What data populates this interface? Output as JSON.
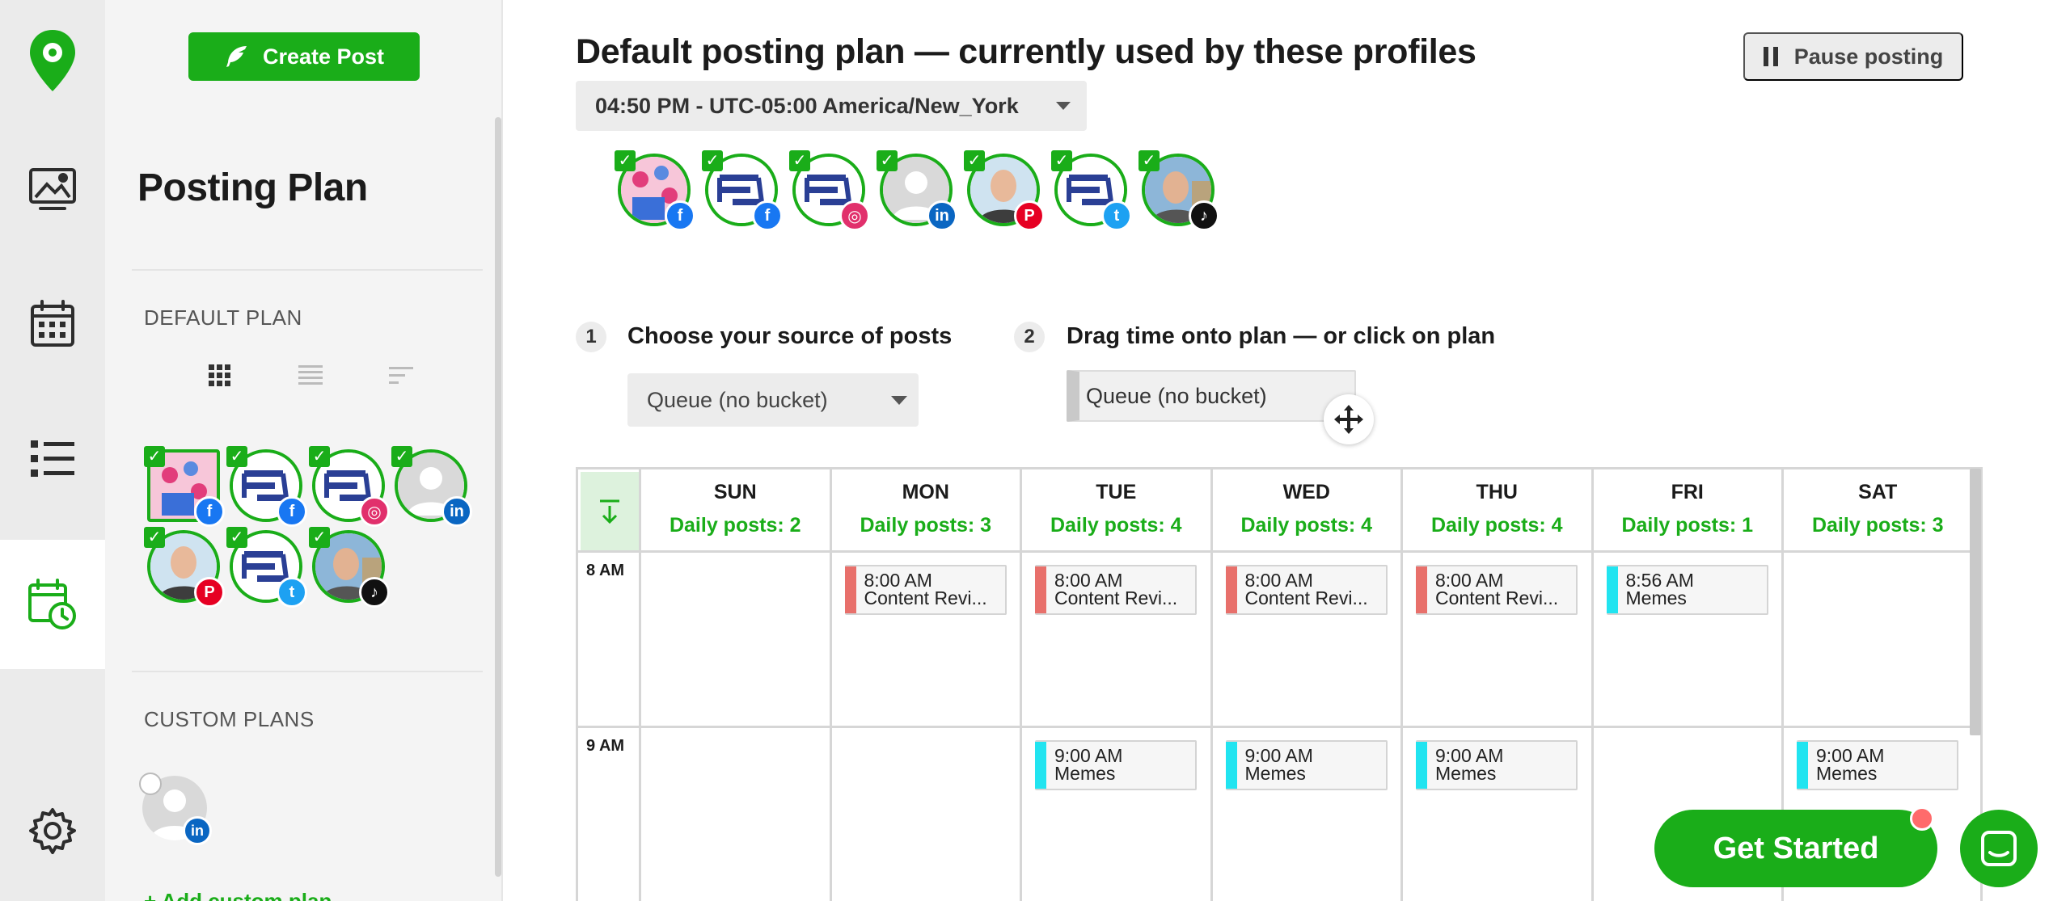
{
  "app": {
    "brand_color": "#1aad19"
  },
  "rail": {
    "items": [
      {
        "icon": "logo-pin-icon"
      },
      {
        "icon": "media-library-icon"
      },
      {
        "icon": "calendar-icon"
      },
      {
        "icon": "list-icon"
      },
      {
        "icon": "posting-plan-icon",
        "active": true
      },
      {
        "icon": "gear-icon"
      }
    ]
  },
  "sidebar": {
    "create_post_label": "Create Post",
    "title": "Posting Plan",
    "default_plan_label": "DEFAULT PLAN",
    "custom_plans_label": "CUSTOM PLANS",
    "add_custom_plan_label": "+ Add custom plan",
    "view_modes": [
      "grid-view-icon",
      "list-view-icon",
      "compact-view-icon"
    ],
    "default_profiles": [
      {
        "network": "facebook",
        "avatar": "flowers-avatar"
      },
      {
        "network": "facebook",
        "avatar": "brand-logo-avatar"
      },
      {
        "network": "instagram",
        "avatar": "brand-logo-avatar"
      },
      {
        "network": "linkedin",
        "avatar": "default-person-avatar"
      },
      {
        "network": "pinterest",
        "avatar": "person-photo-avatar"
      },
      {
        "network": "twitter",
        "avatar": "brand-logo-avatar"
      },
      {
        "network": "tiktok",
        "avatar": "person-photo-avatar"
      }
    ],
    "custom_profiles": [
      {
        "network": "linkedin",
        "avatar": "default-person-avatar"
      }
    ]
  },
  "main": {
    "title": "Default posting plan — currently used by these profiles",
    "timezone": "04:50 PM - UTC-05:00 America/New_York",
    "pause_label": "Pause posting",
    "step1": {
      "num": "1",
      "label": "Choose your source of posts",
      "select_value": "Queue (no bucket)"
    },
    "step2": {
      "num": "2",
      "label": "Drag time onto plan — or click on plan",
      "chip_label": "Queue (no bucket)"
    }
  },
  "calendar": {
    "days": [
      {
        "name": "SUN",
        "count": "Daily posts: 2"
      },
      {
        "name": "MON",
        "count": "Daily posts: 3"
      },
      {
        "name": "TUE",
        "count": "Daily posts: 4"
      },
      {
        "name": "WED",
        "count": "Daily posts: 4"
      },
      {
        "name": "THU",
        "count": "Daily posts: 4"
      },
      {
        "name": "FRI",
        "count": "Daily posts: 1"
      },
      {
        "name": "SAT",
        "count": "Daily posts: 3"
      }
    ],
    "hours": [
      "8 AM",
      "9 AM"
    ],
    "slots": [
      {
        "day": 1,
        "hour": 0,
        "time": "8:00 AM",
        "label": "Content Revi...",
        "color": "#e8706b"
      },
      {
        "day": 2,
        "hour": 0,
        "time": "8:00 AM",
        "label": "Content Revi...",
        "color": "#e8706b"
      },
      {
        "day": 3,
        "hour": 0,
        "time": "8:00 AM",
        "label": "Content Revi...",
        "color": "#e8706b"
      },
      {
        "day": 4,
        "hour": 0,
        "time": "8:00 AM",
        "label": "Content Revi...",
        "color": "#e8706b"
      },
      {
        "day": 5,
        "hour": 0,
        "time": "8:56 AM",
        "label": "Memes",
        "color": "#21e4f0"
      },
      {
        "day": 2,
        "hour": 1,
        "time": "9:00 AM",
        "label": "Memes",
        "color": "#21e4f0"
      },
      {
        "day": 3,
        "hour": 1,
        "time": "9:00 AM",
        "label": "Memes",
        "color": "#21e4f0"
      },
      {
        "day": 4,
        "hour": 1,
        "time": "9:00 AM",
        "label": "Memes",
        "color": "#21e4f0"
      },
      {
        "day": 6,
        "hour": 1,
        "time": "9:00 AM",
        "label": "Memes",
        "color": "#21e4f0"
      }
    ]
  },
  "floating": {
    "get_started_label": "Get Started",
    "chat_icon": "chat-icon"
  }
}
